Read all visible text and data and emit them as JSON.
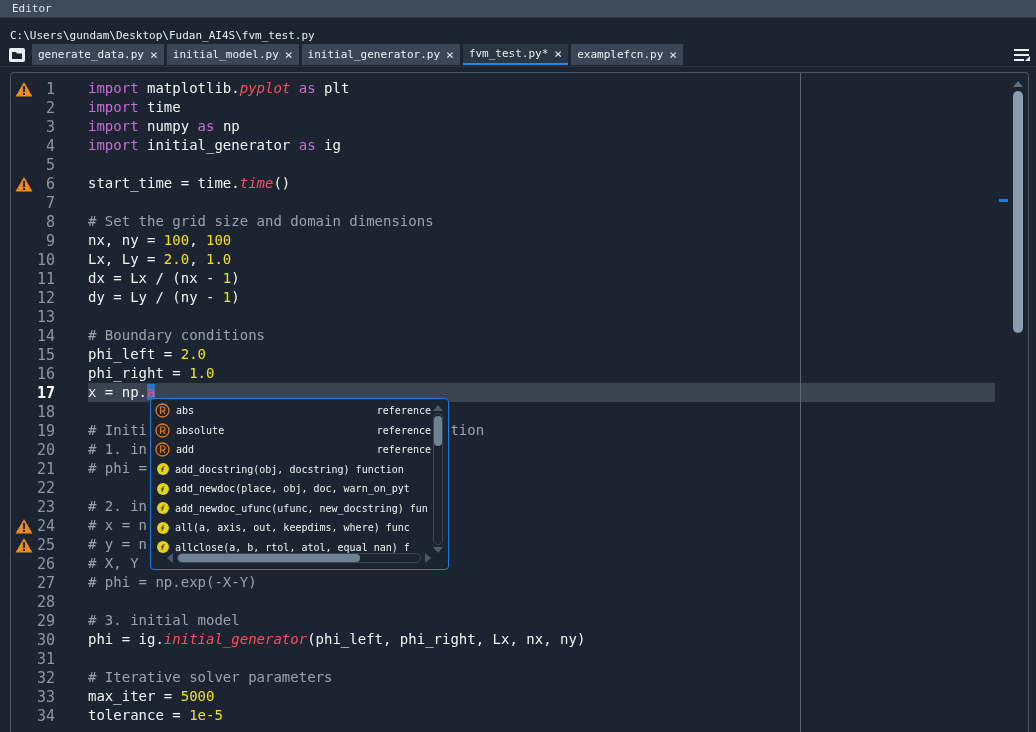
{
  "window": {
    "title": "Editor"
  },
  "path": "C:\\Users\\gundam\\Desktop\\Fudan_AI4S\\fvm_test.py",
  "tabs": [
    {
      "label": "generate_data.py",
      "close": "×",
      "selected": false
    },
    {
      "label": "initial_model.py",
      "close": "×",
      "selected": false
    },
    {
      "label": "initial_generator.py",
      "close": "×",
      "selected": false
    },
    {
      "label": "fvm_test.py*",
      "close": "×",
      "selected": true
    },
    {
      "label": "examplefcn.py",
      "close": "×",
      "selected": false
    }
  ],
  "editor": {
    "lines": [
      {
        "n": "1",
        "warning": true,
        "current": false,
        "tokens": [
          {
            "kind": "keyword",
            "t": "import"
          },
          {
            "kind": "plain",
            "t": " matplotlib."
          },
          {
            "kind": "function",
            "t": "pyplot"
          },
          {
            "kind": "keyword",
            "t": " as"
          },
          {
            "kind": "plain",
            "t": " plt"
          }
        ]
      },
      {
        "n": "2",
        "warning": false,
        "current": false,
        "tokens": [
          {
            "kind": "keyword",
            "t": "import"
          },
          {
            "kind": "plain",
            "t": " time"
          }
        ]
      },
      {
        "n": "3",
        "warning": false,
        "current": false,
        "tokens": [
          {
            "kind": "keyword",
            "t": "import"
          },
          {
            "kind": "plain",
            "t": " numpy "
          },
          {
            "kind": "keyword",
            "t": "as"
          },
          {
            "kind": "plain",
            "t": " np"
          }
        ]
      },
      {
        "n": "4",
        "warning": false,
        "current": false,
        "tokens": [
          {
            "kind": "keyword",
            "t": "import"
          },
          {
            "kind": "plain",
            "t": " initial_generator "
          },
          {
            "kind": "keyword",
            "t": "as"
          },
          {
            "kind": "plain",
            "t": " ig"
          }
        ]
      },
      {
        "n": "5",
        "warning": false,
        "current": false
      },
      {
        "n": "6",
        "warning": true,
        "current": false,
        "tokens": [
          {
            "kind": "plain",
            "t": "start_time = time."
          },
          {
            "kind": "function",
            "t": "time"
          },
          {
            "kind": "plain",
            "t": "()"
          }
        ]
      },
      {
        "n": "7",
        "warning": false,
        "current": false
      },
      {
        "n": "8",
        "warning": false,
        "current": false,
        "tokens": [
          {
            "kind": "comment",
            "t": "# Set the grid size and domain dimensions"
          }
        ]
      },
      {
        "n": "9",
        "warning": false,
        "current": false,
        "tokens": [
          {
            "kind": "plain",
            "t": "nx, ny = "
          },
          {
            "kind": "number",
            "t": "100"
          },
          {
            "kind": "plain",
            "t": ", "
          },
          {
            "kind": "number",
            "t": "100"
          }
        ]
      },
      {
        "n": "10",
        "warning": false,
        "current": false,
        "tokens": [
          {
            "kind": "plain",
            "t": "Lx, Ly = "
          },
          {
            "kind": "number",
            "t": "2.0"
          },
          {
            "kind": "plain",
            "t": ", "
          },
          {
            "kind": "number",
            "t": "1.0"
          }
        ]
      },
      {
        "n": "11",
        "warning": false,
        "current": false,
        "tokens": [
          {
            "kind": "plain",
            "t": "dx = Lx / (nx - "
          },
          {
            "kind": "number",
            "t": "1"
          },
          {
            "kind": "plain",
            "t": ")"
          }
        ]
      },
      {
        "n": "12",
        "warning": false,
        "current": false,
        "tokens": [
          {
            "kind": "plain",
            "t": "dy = Ly / (ny - "
          },
          {
            "kind": "number",
            "t": "1"
          },
          {
            "kind": "plain",
            "t": ")"
          }
        ]
      },
      {
        "n": "13",
        "warning": false,
        "current": false
      },
      {
        "n": "14",
        "warning": false,
        "current": false,
        "tokens": [
          {
            "kind": "comment",
            "t": "# Boundary conditions"
          }
        ]
      },
      {
        "n": "15",
        "warning": false,
        "current": false,
        "tokens": [
          {
            "kind": "plain",
            "t": "phi_left = "
          },
          {
            "kind": "number",
            "t": "2.0"
          }
        ]
      },
      {
        "n": "16",
        "warning": false,
        "current": false,
        "tokens": [
          {
            "kind": "plain",
            "t": "phi_right = "
          },
          {
            "kind": "number",
            "t": "1.0"
          }
        ]
      },
      {
        "n": "17",
        "warning": false,
        "current": true,
        "tokens": [
          {
            "kind": "plain",
            "t": "x = np."
          },
          {
            "kind": "selection",
            "t": "a"
          }
        ]
      },
      {
        "n": "18",
        "warning": false,
        "current": false
      },
      {
        "n": "19",
        "warning": false,
        "current": false,
        "tokens": [
          {
            "kind": "comment",
            "t": "# Initi"
          },
          {
            "kind": "tail",
            "t": "tion"
          }
        ]
      },
      {
        "n": "20",
        "warning": false,
        "current": false,
        "tokens": [
          {
            "kind": "comment",
            "t": "# 1. in"
          }
        ]
      },
      {
        "n": "21",
        "warning": false,
        "current": false,
        "tokens": [
          {
            "kind": "comment",
            "t": "# phi ="
          }
        ]
      },
      {
        "n": "22",
        "warning": false,
        "current": false
      },
      {
        "n": "23",
        "warning": false,
        "current": false,
        "tokens": [
          {
            "kind": "comment",
            "t": "# 2. in"
          }
        ]
      },
      {
        "n": "24",
        "warning": true,
        "current": false,
        "tokens": [
          {
            "kind": "comment",
            "t": "# x = n"
          }
        ]
      },
      {
        "n": "25",
        "warning": true,
        "current": false,
        "tokens": [
          {
            "kind": "comment",
            "t": "# y = n"
          }
        ]
      },
      {
        "n": "26",
        "warning": false,
        "current": false,
        "tokens": [
          {
            "kind": "comment",
            "t": "# X, Y"
          }
        ]
      },
      {
        "n": "27",
        "warning": false,
        "current": false,
        "tokens": [
          {
            "kind": "comment",
            "t": "# phi = np.exp(-X-Y)"
          }
        ]
      },
      {
        "n": "28",
        "warning": false,
        "current": false
      },
      {
        "n": "29",
        "warning": false,
        "current": false,
        "tokens": [
          {
            "kind": "comment",
            "t": "# 3. initial model"
          }
        ]
      },
      {
        "n": "30",
        "warning": false,
        "current": false,
        "tokens": [
          {
            "kind": "plain",
            "t": "phi = ig."
          },
          {
            "kind": "function",
            "t": "initial_generator"
          },
          {
            "kind": "plain",
            "t": "(phi_left, phi_right, Lx, nx, ny)"
          }
        ]
      },
      {
        "n": "31",
        "warning": false,
        "current": false
      },
      {
        "n": "32",
        "warning": false,
        "current": false,
        "tokens": [
          {
            "kind": "comment",
            "t": "# Iterative solver parameters"
          }
        ]
      },
      {
        "n": "33",
        "warning": false,
        "current": false,
        "tokens": [
          {
            "kind": "plain",
            "t": "max_iter = "
          },
          {
            "kind": "number",
            "t": "5000"
          }
        ]
      },
      {
        "n": "34",
        "warning": false,
        "current": false,
        "tokens": [
          {
            "kind": "plain",
            "t": "tolerance = "
          },
          {
            "kind": "number",
            "t": "1e-5"
          }
        ]
      }
    ]
  },
  "completion": {
    "items": [
      {
        "kind": "reference",
        "label": "abs",
        "type": "reference"
      },
      {
        "kind": "reference",
        "label": "absolute",
        "type": "reference"
      },
      {
        "kind": "reference",
        "label": "add",
        "type": "reference"
      },
      {
        "kind": "function",
        "label": "add_docstring(obj, docstring)",
        "type": "function"
      },
      {
        "kind": "function",
        "label": "add_newdoc(place, obj, doc, warn_on_pyt"
      },
      {
        "kind": "function",
        "label": "add_newdoc_ufunc(ufunc, new_docstring)",
        "type": "fun"
      },
      {
        "kind": "function",
        "label": "all(a, axis, out, keepdims, where)",
        "type": "func"
      },
      {
        "kind": "function",
        "label": "allclose(a, b, rtol, atol, equal_nan)",
        "type": "f"
      }
    ]
  }
}
